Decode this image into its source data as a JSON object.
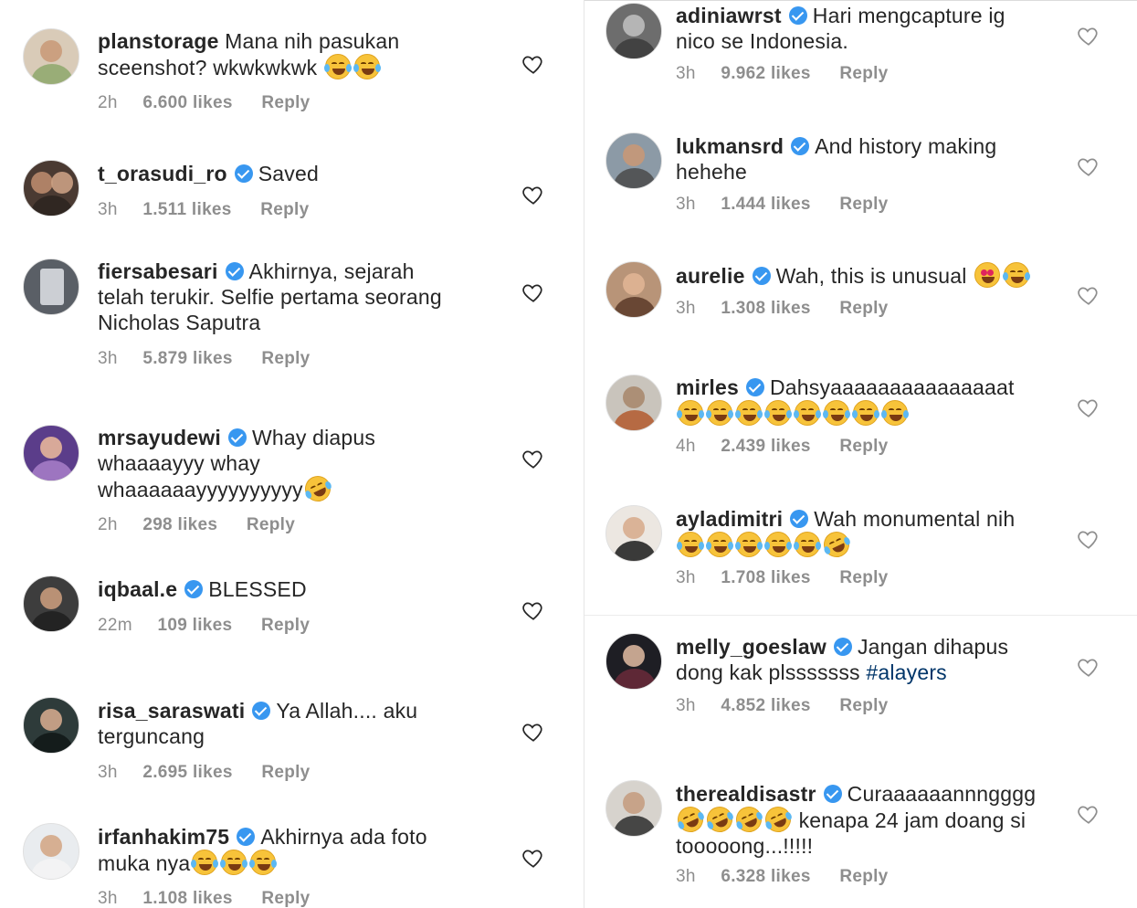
{
  "colors": {
    "text": "#262626",
    "meta": "#8e8e8e",
    "verified_badge": "#3897f0",
    "hashtag": "#003569"
  },
  "left_comments": [
    {
      "username": "planstorage",
      "verified": false,
      "line1": "Mana nih pasukan",
      "line2": "sceenshot? wkwkwkwk",
      "line3": "",
      "emojis": "laugh-cry-emoji x2",
      "time": "2h",
      "likes": "6.600 likes",
      "reply": "Reply"
    },
    {
      "username": "t_orasudi_ro",
      "verified": true,
      "line1": "Saved",
      "line2": "",
      "line3": "",
      "time": "3h",
      "likes": "1.511 likes",
      "reply": "Reply"
    },
    {
      "username": "fiersabesari",
      "verified": true,
      "line1": "Akhirnya, sejarah",
      "line2": "telah terukir. Selfie pertama seorang",
      "line3": "Nicholas Saputra",
      "time": "3h",
      "likes": "5.879 likes",
      "reply": "Reply"
    },
    {
      "username": "mrsayudewi",
      "verified": true,
      "line1": "Whay diapus",
      "line2": "whaaaayyy whay",
      "line3": "whaaaaaayyyyyyyyyy",
      "emojis": "rofl-emoji",
      "time": "2h",
      "likes": "298 likes",
      "reply": "Reply"
    },
    {
      "username": "iqbaal.e",
      "verified": true,
      "line1": "BLESSED",
      "line2": "",
      "line3": "",
      "time": "22m",
      "likes": "109 likes",
      "reply": "Reply"
    },
    {
      "username": "risa_saraswati",
      "verified": true,
      "line1": "Ya Allah.... aku",
      "line2": "terguncang",
      "line3": "",
      "time": "3h",
      "likes": "2.695 likes",
      "reply": "Reply"
    },
    {
      "username": "irfanhakim75",
      "verified": true,
      "line1": "Akhirnya ada foto",
      "line2": "muka nya",
      "line3": "",
      "emojis": "laugh-cry-emoji x3",
      "time": "3h",
      "likes": "1.108 likes",
      "reply": "Reply"
    }
  ],
  "right_comments": [
    {
      "username": "adiniawrst",
      "verified": true,
      "line1": "Hari mengcapture ig",
      "line2": "nico se Indonesia.",
      "time": "3h",
      "likes": "9.962 likes",
      "reply": "Reply"
    },
    {
      "username": "lukmansrd",
      "verified": true,
      "line1": "And history making",
      "line2": "hehehe",
      "time": "3h",
      "likes": "1.444 likes",
      "reply": "Reply"
    },
    {
      "username": "aurelie",
      "verified": true,
      "line1": "Wah, this is unusual",
      "line2": "",
      "emojis": "heart-eyes-emoji, laugh-cry-emoji",
      "time": "3h",
      "likes": "1.308 likes",
      "reply": "Reply"
    },
    {
      "username": "mirles",
      "verified": true,
      "line1": "Dahsyaaaaaaaaaaaaaaat",
      "line2": "",
      "emojis": "laugh-cry-emoji x8",
      "time": "4h",
      "likes": "2.439 likes",
      "reply": "Reply"
    },
    {
      "username": "ayladimitri",
      "verified": true,
      "line1": "Wah monumental nih",
      "line2": "",
      "emojis": "laugh-cry-emoji x5, rofl-emoji",
      "time": "3h",
      "likes": "1.708 likes",
      "reply": "Reply"
    },
    {
      "username": "melly_goeslaw",
      "verified": true,
      "line1": "Jangan dihapus",
      "line2": "dong kak plsssssss",
      "hashtag": "#alayers",
      "time": "3h",
      "likes": "4.852 likes",
      "reply": "Reply"
    },
    {
      "username": "therealdisastr",
      "verified": true,
      "line1": "Curaaaaaannngggg",
      "line2": "kenapa 24 jam doang si",
      "line3": "tooooong...!!!!!",
      "emojis": "rofl-emoji x4",
      "time": "3h",
      "likes": "6.328 likes",
      "reply": "Reply"
    }
  ]
}
